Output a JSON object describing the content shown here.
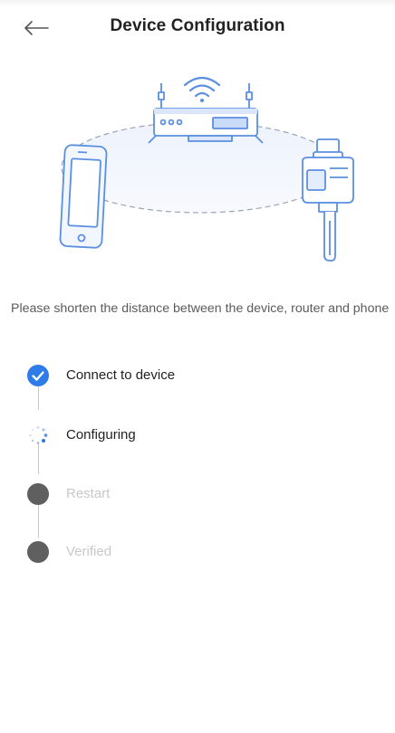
{
  "header": {
    "title": "Device Configuration",
    "back_icon": "arrow-left-icon"
  },
  "illustration": {
    "icons": [
      "router-icon",
      "wifi-icon",
      "phone-icon",
      "device-icon"
    ],
    "accent": "#5b8fe0"
  },
  "hint": "Please shorten the distance between the device, router and phone",
  "steps": [
    {
      "label": "Connect to device",
      "status": "done"
    },
    {
      "label": "Configuring",
      "status": "in-progress"
    },
    {
      "label": "Restart",
      "status": "pending"
    },
    {
      "label": "Verified",
      "status": "pending"
    }
  ],
  "colors": {
    "done": "#2f7bea",
    "pending_dot": "#5f5f5f",
    "pending_text": "#c8c8c8",
    "line": "#c9c9c9"
  }
}
